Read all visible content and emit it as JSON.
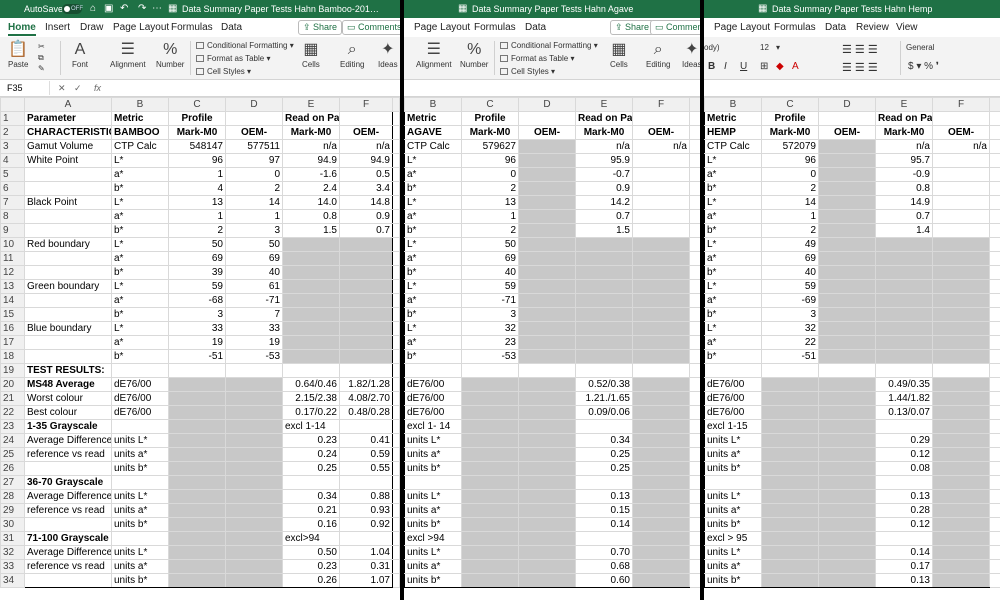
{
  "tabs": [
    "Home",
    "Insert",
    "Draw",
    "Page Layout",
    "Formulas",
    "Data",
    "Review",
    "View"
  ],
  "share_label": "Share",
  "comments_label": "Comments",
  "ribbon": {
    "paste": "Paste",
    "font": "Font",
    "alignment": "Alignment",
    "number": "Number",
    "conditional_formatting": "Conditional Formatting",
    "format_as_table": "Format as Table",
    "cell_styles": "Cell Styles",
    "cells": "Cells",
    "editing": "Editing",
    "ideas": "Ideas",
    "font_size": "12",
    "font_name_partial": "ody)",
    "number_format": "General",
    "autosave": "AutoSave",
    "autosave_state": "OFF"
  },
  "name_box": "F35",
  "fx": "fx",
  "windows": [
    {
      "title": "Data Summary Paper Tests Hahn Bamboo-201…",
      "tabs_shown": [
        0,
        1,
        2,
        3,
        4,
        5
      ],
      "columns": [
        "A",
        "B",
        "C",
        "D",
        "E",
        "F"
      ],
      "rows": [
        [
          "Parameter",
          "Metric",
          "Profile",
          "",
          "Read on Paper",
          ""
        ],
        [
          "CHARACTERISTICS:",
          "BAMBOO",
          "Mark-M0",
          "OEM-",
          "Mark-M0",
          "OEM-"
        ],
        [
          "Gamut Volume",
          "CTP Calc",
          "548147",
          "577511",
          "n/a",
          "n/a"
        ],
        [
          "White Point",
          "L*",
          "96",
          "97",
          "94.9",
          "94.9"
        ],
        [
          "",
          "a*",
          "1",
          "0",
          "-1.6",
          "0.5"
        ],
        [
          "",
          "b*",
          "4",
          "2",
          "2.4",
          "3.4"
        ],
        [
          "Black Point",
          "L*",
          "13",
          "14",
          "14.0",
          "14.8"
        ],
        [
          "",
          "a*",
          "1",
          "1",
          "0.8",
          "0.9"
        ],
        [
          "",
          "b*",
          "2",
          "3",
          "1.5",
          "0.7"
        ],
        [
          "Red boundary",
          "L*",
          "50",
          "50",
          "",
          ""
        ],
        [
          "",
          "a*",
          "69",
          "69",
          "",
          ""
        ],
        [
          "",
          "b*",
          "39",
          "40",
          "",
          ""
        ],
        [
          "Green boundary",
          "L*",
          "59",
          "61",
          "",
          ""
        ],
        [
          "",
          "a*",
          "-68",
          "-71",
          "",
          ""
        ],
        [
          "",
          "b*",
          "3",
          "7",
          "",
          ""
        ],
        [
          "Blue boundary",
          "L*",
          "33",
          "33",
          "",
          ""
        ],
        [
          "",
          "a*",
          "19",
          "19",
          "",
          ""
        ],
        [
          "",
          "b*",
          "-51",
          "-53",
          "",
          ""
        ],
        [
          "TEST RESULTS:",
          "",
          "",
          "",
          "",
          ""
        ],
        [
          "MS48 Average",
          "dE76/00",
          "",
          "",
          "0.64/0.46",
          "1.82/1.28"
        ],
        [
          "Worst colour",
          "dE76/00",
          "",
          "",
          "2.15/2.38",
          "4.08/2.70"
        ],
        [
          "Best colour",
          "dE76/00",
          "",
          "",
          "0.17/0.22",
          "0.48/0.28"
        ],
        [
          "1-35 Grayscale",
          "",
          "",
          "",
          "excl 1-14",
          ""
        ],
        [
          "Average Difference",
          "units L*",
          "",
          "",
          "0.23",
          "0.41"
        ],
        [
          "reference vs read",
          "units a*",
          "",
          "",
          "0.24",
          "0.59"
        ],
        [
          "",
          "units b*",
          "",
          "",
          "0.25",
          "0.55"
        ],
        [
          "36-70  Grayscale",
          "",
          "",
          "",
          "",
          ""
        ],
        [
          "Average Difference",
          "units L*",
          "",
          "",
          "0.34",
          "0.88"
        ],
        [
          "reference vs read",
          "units a*",
          "",
          "",
          "0.21",
          "0.93"
        ],
        [
          "",
          "units b*",
          "",
          "",
          "0.16",
          "0.92"
        ],
        [
          "71-100  Grayscale",
          "",
          "",
          "",
          "excl>94",
          ""
        ],
        [
          "Average Difference",
          "units L*",
          "",
          "",
          "0.50",
          "1.04"
        ],
        [
          "reference vs read",
          "units a*",
          "",
          "",
          "0.23",
          "0.31"
        ],
        [
          "",
          "units b*",
          "",
          "",
          "0.26",
          "1.07"
        ]
      ]
    },
    {
      "title": "Data Summary Paper Tests Hahn Agave",
      "columns": [
        "B",
        "C",
        "D",
        "E",
        "F"
      ],
      "rows": [
        [
          "Metric",
          "Profile",
          "",
          "Read on Paper",
          ""
        ],
        [
          "AGAVE",
          "Mark-M0",
          "OEM-",
          "Mark-M0",
          "OEM-"
        ],
        [
          "CTP Calc",
          "579627",
          "",
          "n/a",
          "n/a"
        ],
        [
          "L*",
          "96",
          "",
          "95.9",
          ""
        ],
        [
          "a*",
          "0",
          "",
          "-0.7",
          ""
        ],
        [
          "b*",
          "2",
          "",
          "0.9",
          ""
        ],
        [
          "L*",
          "13",
          "",
          "14.2",
          ""
        ],
        [
          "a*",
          "1",
          "",
          "0.7",
          ""
        ],
        [
          "b*",
          "2",
          "",
          "1.5",
          ""
        ],
        [
          "L*",
          "50",
          "",
          "",
          ""
        ],
        [
          "a*",
          "69",
          "",
          "",
          ""
        ],
        [
          "b*",
          "40",
          "",
          "",
          ""
        ],
        [
          "L*",
          "59",
          "",
          "",
          ""
        ],
        [
          "a*",
          "-71",
          "",
          "",
          ""
        ],
        [
          "b*",
          "3",
          "",
          "",
          ""
        ],
        [
          "L*",
          "32",
          "",
          "",
          ""
        ],
        [
          "a*",
          "23",
          "",
          "",
          ""
        ],
        [
          "b*",
          "-53",
          "",
          "",
          ""
        ],
        [
          "",
          "",
          "",
          "",
          ""
        ],
        [
          "dE76/00",
          "",
          "",
          "0.52/0.38",
          ""
        ],
        [
          "dE76/00",
          "",
          "",
          "1.21./1.65",
          ""
        ],
        [
          "dE76/00",
          "",
          "",
          "0.09/0.06",
          ""
        ],
        [
          "excl 1- 14",
          "",
          "",
          "",
          ""
        ],
        [
          "units L*",
          "",
          "",
          "0.34",
          ""
        ],
        [
          "units a*",
          "",
          "",
          "0.25",
          ""
        ],
        [
          "units b*",
          "",
          "",
          "0.25",
          ""
        ],
        [
          "",
          "",
          "",
          "",
          ""
        ],
        [
          "units L*",
          "",
          "",
          "0.13",
          ""
        ],
        [
          "units a*",
          "",
          "",
          "0.15",
          ""
        ],
        [
          "units b*",
          "",
          "",
          "0.14",
          ""
        ],
        [
          "excl >94",
          "",
          "",
          "",
          ""
        ],
        [
          "units L*",
          "",
          "",
          "0.70",
          ""
        ],
        [
          "units a*",
          "",
          "",
          "0.68",
          ""
        ],
        [
          "units b*",
          "",
          "",
          "0.60",
          ""
        ]
      ]
    },
    {
      "title": "Data Summary Paper Tests Hahn Hemp",
      "columns": [
        "B",
        "C",
        "D",
        "E",
        "F"
      ],
      "rows": [
        [
          "Metric",
          "Profile",
          "",
          "Read on Paper",
          ""
        ],
        [
          "HEMP",
          "Mark-M0",
          "OEM-",
          "Mark-M0",
          "OEM-"
        ],
        [
          "CTP Calc",
          "572079",
          "",
          "n/a",
          "n/a"
        ],
        [
          "L*",
          "96",
          "",
          "95.7",
          ""
        ],
        [
          "a*",
          "0",
          "",
          "-0.9",
          ""
        ],
        [
          "b*",
          "2",
          "",
          "0.8",
          ""
        ],
        [
          "L*",
          "14",
          "",
          "14.9",
          ""
        ],
        [
          "a*",
          "1",
          "",
          "0.7",
          ""
        ],
        [
          "b*",
          "2",
          "",
          "1.4",
          ""
        ],
        [
          "L*",
          "49",
          "",
          "",
          ""
        ],
        [
          "a*",
          "69",
          "",
          "",
          ""
        ],
        [
          "b*",
          "40",
          "",
          "",
          ""
        ],
        [
          "L*",
          "59",
          "",
          "",
          ""
        ],
        [
          "a*",
          "-69",
          "",
          "",
          ""
        ],
        [
          "b*",
          "3",
          "",
          "",
          ""
        ],
        [
          "L*",
          "32",
          "",
          "",
          ""
        ],
        [
          "a*",
          "22",
          "",
          "",
          ""
        ],
        [
          "b*",
          "-51",
          "",
          "",
          ""
        ],
        [
          "",
          "",
          "",
          "",
          ""
        ],
        [
          "dE76/00",
          "",
          "",
          "0.49/0.35",
          ""
        ],
        [
          "dE76/00",
          "",
          "",
          "1.44/1.82",
          ""
        ],
        [
          "dE76/00",
          "",
          "",
          "0.13/0.07",
          ""
        ],
        [
          "excl 1-15",
          "",
          "",
          "",
          ""
        ],
        [
          "units L*",
          "",
          "",
          "0.29",
          ""
        ],
        [
          "units a*",
          "",
          "",
          "0.12",
          ""
        ],
        [
          "units b*",
          "",
          "",
          "0.08",
          ""
        ],
        [
          "",
          "",
          "",
          "",
          ""
        ],
        [
          "units L*",
          "",
          "",
          "0.13",
          ""
        ],
        [
          "units a*",
          "",
          "",
          "0.28",
          ""
        ],
        [
          "units b*",
          "",
          "",
          "0.12",
          ""
        ],
        [
          "excl > 95",
          "",
          "",
          "",
          ""
        ],
        [
          "units L*",
          "",
          "",
          "0.14",
          ""
        ],
        [
          "units a*",
          "",
          "",
          "0.17",
          ""
        ],
        [
          "units b*",
          "",
          "",
          "0.13",
          ""
        ]
      ]
    }
  ]
}
